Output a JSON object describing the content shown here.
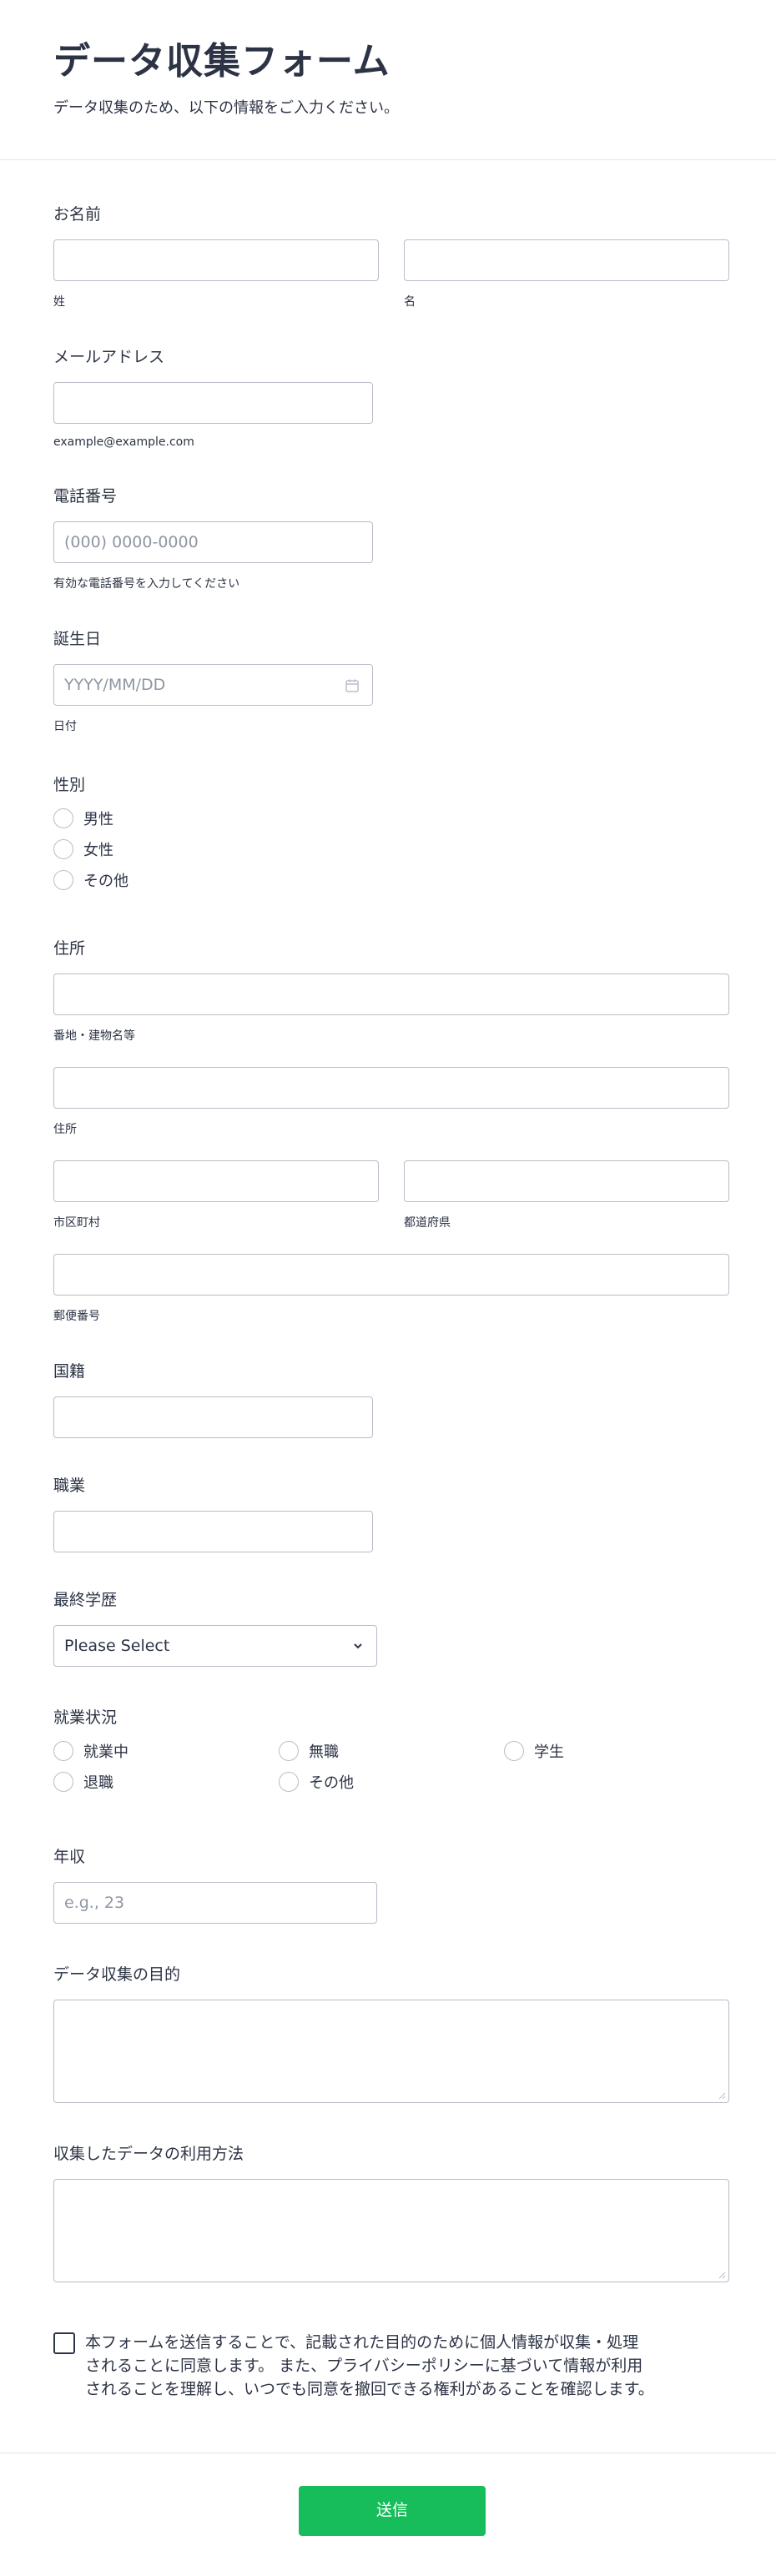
{
  "header": {
    "title": "データ収集フォーム",
    "subtitle": "データ収集のため、以下の情報をご入力ください。"
  },
  "name": {
    "label": "お名前",
    "first_sublabel": "姓",
    "last_sublabel": "名"
  },
  "email": {
    "label": "メールアドレス",
    "sublabel": "example@example.com"
  },
  "phone": {
    "label": "電話番号",
    "placeholder": "(000) 0000-0000",
    "sublabel": "有効な電話番号を入力してください"
  },
  "birthday": {
    "label": "誕生日",
    "placeholder": "YYYY/MM/DD",
    "sublabel": "日付",
    "icon": "calendar-icon"
  },
  "gender": {
    "label": "性別",
    "options": [
      "男性",
      "女性",
      "その他"
    ]
  },
  "address": {
    "label": "住所",
    "street_sublabel": "番地・建物名等",
    "address_sublabel": "住所",
    "city_sublabel": "市区町村",
    "prefecture_sublabel": "都道府県",
    "postal_sublabel": "郵便番号"
  },
  "nationality": {
    "label": "国籍"
  },
  "occupation": {
    "label": "職業"
  },
  "education": {
    "label": "最終学歴",
    "selected": "Please Select"
  },
  "employment": {
    "label": "就業状況",
    "options": [
      "就業中",
      "無職",
      "学生",
      "退職",
      "その他"
    ]
  },
  "income": {
    "label": "年収",
    "placeholder": "e.g., 23"
  },
  "purpose": {
    "label": "データ収集の目的"
  },
  "usage": {
    "label": "収集したデータの利用方法"
  },
  "consent": {
    "text": "本フォームを送信することで、記載された目的のために個人情報が収集・処理されることに同意します。 また、プライバシーポリシーに基づいて情報が利用されることを理解し、いつでも同意を撤回できる権利があることを確認します。"
  },
  "submit": {
    "label": "送信"
  },
  "colors": {
    "accent": "#18bd5b",
    "text": "#2c3345",
    "border": "#b8bdc9"
  }
}
